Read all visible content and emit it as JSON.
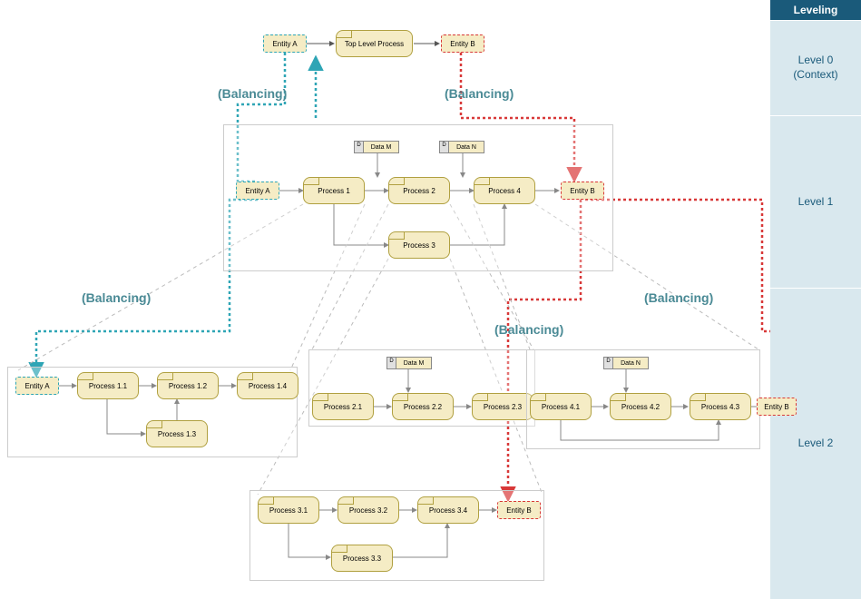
{
  "sidebar": {
    "header": "Leveling",
    "levels": [
      "Level 0\n(Context)",
      "Level 1",
      "Level 2"
    ]
  },
  "balancing": "(Balancing)",
  "level0": {
    "entity_a": "Entity A",
    "process": "Top Level Process",
    "entity_b": "Entity B"
  },
  "level1": {
    "entity_a": "Entity A",
    "data_m": "Data M",
    "data_n": "Data N",
    "p1": "Process 1",
    "p2": "Process 2",
    "p3": "Process 3",
    "p4": "Process 4",
    "entity_b": "Entity B",
    "d_tab": "D"
  },
  "level2": {
    "box1": {
      "entity_a": "Entity A",
      "p11": "Process 1.1",
      "p12": "Process 1.2",
      "p13": "Process 1.3",
      "p14": "Process 1.4"
    },
    "box2": {
      "data_m": "Data M",
      "p21": "Process 2.1",
      "p22": "Process 2.2",
      "p23": "Process 2.3"
    },
    "box3": {
      "p31": "Process 3.1",
      "p32": "Process 3.2",
      "p33": "Process 3.3",
      "p34": "Process 3.4",
      "entity_b": "Entity B"
    },
    "box4": {
      "data_n": "Data N",
      "p41": "Process 4.1",
      "p42": "Process 4.2",
      "p43": "Process 4.3",
      "entity_b": "Entity B"
    }
  },
  "chart_data": {
    "type": "diagram",
    "diagram_type": "Data Flow Diagram - Leveling and Balancing",
    "levels": [
      {
        "name": "Level 0 (Context)",
        "entities": [
          "Entity A",
          "Entity B"
        ],
        "processes": [
          "Top Level Process"
        ],
        "flows": [
          [
            "Entity A",
            "Top Level Process"
          ],
          [
            "Top Level Process",
            "Entity B"
          ]
        ]
      },
      {
        "name": "Level 1",
        "entities": [
          "Entity A",
          "Entity B"
        ],
        "datastores": [
          "Data M",
          "Data N"
        ],
        "processes": [
          "Process 1",
          "Process 2",
          "Process 3",
          "Process 4"
        ],
        "flows": [
          [
            "Entity A",
            "Process 1"
          ],
          [
            "Process 1",
            "Process 2"
          ],
          [
            "Process 2",
            "Process 4"
          ],
          [
            "Process 1",
            "Process 3"
          ],
          [
            "Process 3",
            "Process 4"
          ],
          [
            "Data M",
            "Process 2"
          ],
          [
            "Data N",
            "Process 4"
          ],
          [
            "Process 4",
            "Entity B"
          ]
        ]
      },
      {
        "name": "Level 2",
        "subdiagrams": [
          {
            "decomposes": "Process 1",
            "entities": [
              "Entity A"
            ],
            "processes": [
              "Process 1.1",
              "Process 1.2",
              "Process 1.3",
              "Process 1.4"
            ],
            "flows": [
              [
                "Entity A",
                "Process 1.1"
              ],
              [
                "Process 1.1",
                "Process 1.2"
              ],
              [
                "Process 1.2",
                "Process 1.4"
              ],
              [
                "Process 1.1",
                "Process 1.3"
              ],
              [
                "Process 1.3",
                "Process 1.2"
              ]
            ]
          },
          {
            "decomposes": "Process 2",
            "datastores": [
              "Data M"
            ],
            "processes": [
              "Process 2.1",
              "Process 2.2",
              "Process 2.3"
            ],
            "flows": [
              [
                "Process 2.1",
                "Process 2.2"
              ],
              [
                "Process 2.2",
                "Process 2.3"
              ],
              [
                "Data M",
                "Process 2.2"
              ]
            ]
          },
          {
            "decomposes": "Process 3",
            "entities": [
              "Entity B"
            ],
            "processes": [
              "Process 3.1",
              "Process 3.2",
              "Process 3.3",
              "Process 3.4"
            ],
            "flows": [
              [
                "Process 3.1",
                "Process 3.2"
              ],
              [
                "Process 3.2",
                "Process 3.4"
              ],
              [
                "Process 3.1",
                "Process 3.3"
              ],
              [
                "Process 3.3",
                "Process 3.4"
              ],
              [
                "Process 3.4",
                "Entity B"
              ]
            ]
          },
          {
            "decomposes": "Process 4",
            "entities": [
              "Entity B"
            ],
            "datastores": [
              "Data N"
            ],
            "processes": [
              "Process 4.1",
              "Process 4.2",
              "Process 4.3"
            ],
            "flows": [
              [
                "Process 4.1",
                "Process 4.2"
              ],
              [
                "Process 4.2",
                "Process 4.3"
              ],
              [
                "Data N",
                "Process 4.2"
              ],
              [
                "Process 4.3",
                "Entity B"
              ],
              [
                "Process 4.1",
                "Process 4.3"
              ]
            ]
          }
        ]
      }
    ],
    "balancing_connections": [
      {
        "from": "Level 0 Entity A",
        "to": "Level 1 Entity A",
        "color": "teal"
      },
      {
        "from": "Level 0 Entity B",
        "to": "Level 1 Entity B",
        "color": "red"
      },
      {
        "from": "Level 1 Entity A",
        "to": "Level 2 Box1 Entity A",
        "color": "teal"
      },
      {
        "from": "Level 1 Entity B",
        "to": "Level 2 Box4 Entity B",
        "color": "red"
      },
      {
        "from": "Level 1 Entity B",
        "to": "Level 2 Box3 Entity B",
        "color": "red"
      }
    ]
  }
}
